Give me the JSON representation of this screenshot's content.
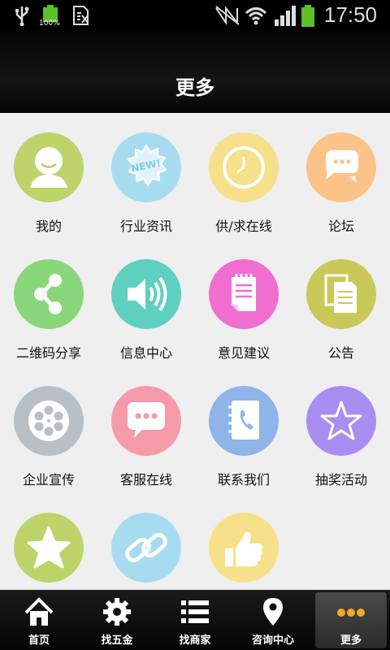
{
  "status": {
    "time": "17:50",
    "battery": "100%",
    "sim_icon": "sim-icon"
  },
  "header": {
    "title": "更多"
  },
  "colors": {
    "green": "#bcd46a",
    "blue": "#a7dcf0",
    "yellow": "#f7e08a",
    "orange": "#fbc38a",
    "lightgreen": "#8ad67a",
    "teal": "#5fcfc0",
    "pink": "#f06ecf",
    "olive": "#c9c95a",
    "gray": "#b8c0c6",
    "rose": "#f49aa8",
    "steel": "#8fb4e8",
    "purple": "#a88ef0"
  },
  "items": [
    {
      "label": "我的",
      "icon": "user-icon"
    },
    {
      "label": "行业资讯",
      "icon": "news-icon"
    },
    {
      "label": "供/求在线",
      "icon": "clock-icon"
    },
    {
      "label": "论坛",
      "icon": "chat-icon"
    },
    {
      "label": "二维码分享",
      "icon": "share-icon"
    },
    {
      "label": "信息中心",
      "icon": "speaker-icon"
    },
    {
      "label": "意见建议",
      "icon": "notepad-icon"
    },
    {
      "label": "公告",
      "icon": "documents-icon"
    },
    {
      "label": "企业宣传",
      "icon": "film-reel-icon"
    },
    {
      "label": "客服在线",
      "icon": "message-icon"
    },
    {
      "label": "联系我们",
      "icon": "address-book-icon"
    },
    {
      "label": "抽奖活动",
      "icon": "star-outline-icon"
    },
    {
      "label": "",
      "icon": "star-icon"
    },
    {
      "label": "",
      "icon": "link-icon"
    },
    {
      "label": "",
      "icon": "thumbs-up-icon"
    }
  ],
  "nav": [
    {
      "label": "首页",
      "icon": "home-icon"
    },
    {
      "label": "找五金",
      "icon": "gear-icon"
    },
    {
      "label": "找商家",
      "icon": "list-icon"
    },
    {
      "label": "咨询中心",
      "icon": "location-pin-icon"
    },
    {
      "label": "更多",
      "icon": "more-dots-icon"
    }
  ]
}
